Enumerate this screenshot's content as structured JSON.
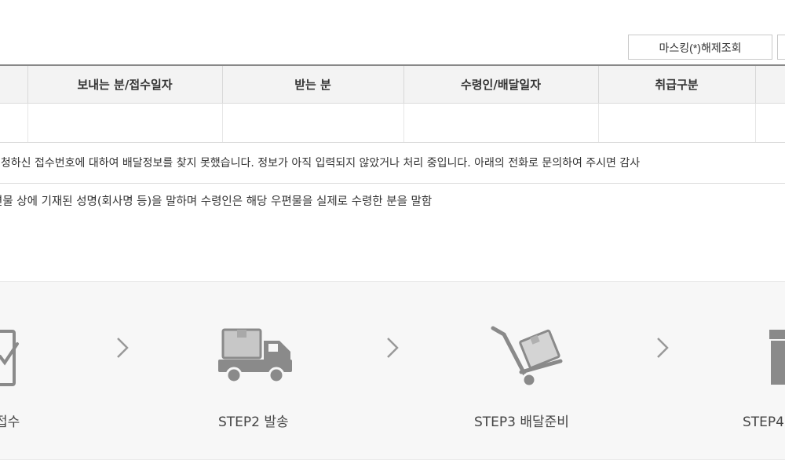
{
  "toolbar": {
    "unmask_button": "마스킹(*)해제조회"
  },
  "table": {
    "headers": [
      "보내는 분/접수일자",
      "받는 분",
      "수령인/배달일자",
      "취급구분"
    ],
    "no_result_message": "신청하신 접수번호에 대하여 배달정보를 찾지 못했습니다. 정보가 아직 입력되지 않았거나 처리 중입니다. 아래의 전화로 문의하여 주시면 감사"
  },
  "note": "편물 상에 기재된 성명(회사명 등)을 말하며 수령인은 해당 우편물을 실제로 수령한 분을 말함",
  "steps": [
    {
      "label": "접수",
      "icon": "clipboard-check-icon"
    },
    {
      "label": "STEP2 발송",
      "icon": "delivery-truck-icon"
    },
    {
      "label": "STEP3 배달준비",
      "icon": "hand-truck-icon"
    },
    {
      "label": "STEP4",
      "icon": "gift-box-icon"
    }
  ],
  "colors": {
    "header_bg": "#f3f3f3",
    "steps_bg": "#f7f7f7",
    "icon": "#8a8a8a"
  }
}
